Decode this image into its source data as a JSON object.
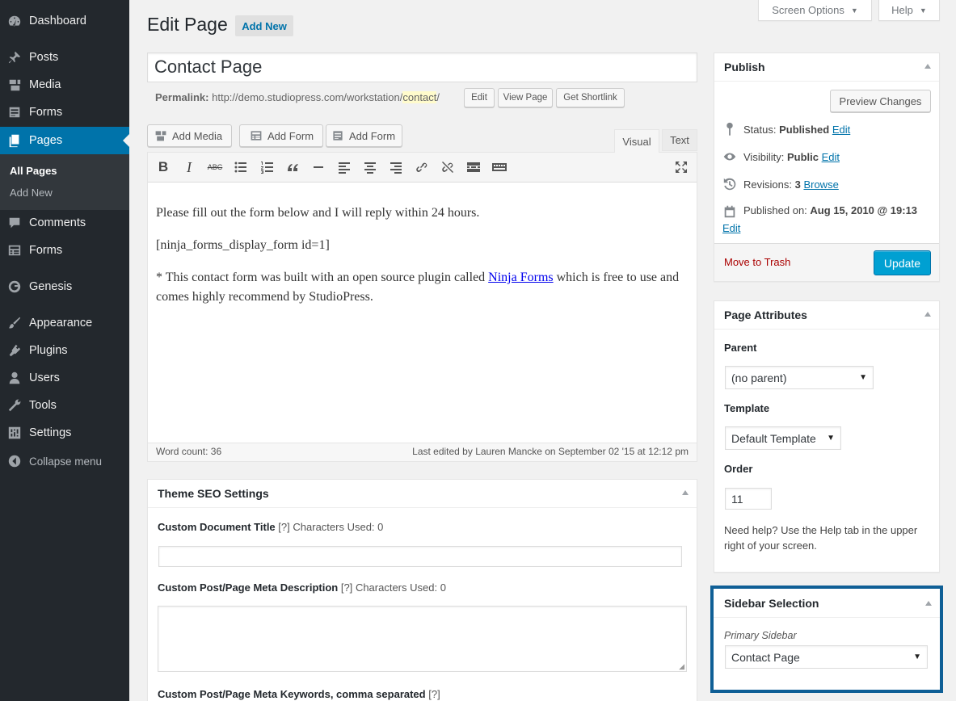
{
  "sidebar": {
    "items": [
      {
        "label": "Dashboard",
        "icon": "dashboard-icon"
      },
      {
        "label": "Posts",
        "icon": "pin-icon"
      },
      {
        "label": "Media",
        "icon": "media-icon"
      },
      {
        "label": "Forms",
        "icon": "form-icon"
      },
      {
        "label": "Pages",
        "icon": "page-icon"
      },
      {
        "label": "Comments",
        "icon": "comment-icon"
      },
      {
        "label": "Forms",
        "icon": "form-icon"
      },
      {
        "label": "Genesis",
        "icon": "genesis-icon"
      },
      {
        "label": "Appearance",
        "icon": "brush-icon"
      },
      {
        "label": "Plugins",
        "icon": "plugin-icon"
      },
      {
        "label": "Users",
        "icon": "user-icon"
      },
      {
        "label": "Tools",
        "icon": "wrench-icon"
      },
      {
        "label": "Settings",
        "icon": "settings-icon"
      },
      {
        "label": "Collapse menu",
        "icon": "collapse-icon"
      }
    ],
    "submenu": {
      "all_pages": "All Pages",
      "add_new": "Add New"
    }
  },
  "topbar": {
    "screen_options": "Screen Options",
    "help": "Help"
  },
  "header": {
    "title": "Edit Page",
    "add_new": "Add New"
  },
  "post": {
    "title": "Contact Page",
    "permalink_label": "Permalink:",
    "permalink_base": "http://demo.studiopress.com/workstation/",
    "permalink_slug": "contact",
    "permalink_end": "/",
    "edit_btn": "Edit",
    "view_btn": "View Page",
    "shortlink_btn": "Get Shortlink"
  },
  "editor": {
    "add_media": "Add Media",
    "add_form_1": "Add Form",
    "add_form_2": "Add Form",
    "tab_visual": "Visual",
    "tab_text": "Text",
    "p1": "Please fill out the form below and I will reply within 24 hours.",
    "p2": "[ninja_forms_display_form id=1]",
    "p3_a": "* This contact form was built with an open source plugin called ",
    "p3_link": "Ninja Forms",
    "p3_b": " which is free to use and comes highly recommend by StudioPress.",
    "word_count": "Word count: 36",
    "last_edited": "Last edited by Lauren Mancke on September 02 '15 at 12:12 pm"
  },
  "seo": {
    "title": "Theme SEO Settings",
    "doc_title_label": "Custom Document Title",
    "doc_title_help": "[?]",
    "doc_title_chars": "Characters Used: 0",
    "desc_label": "Custom Post/Page Meta Description",
    "desc_help": "[?]",
    "desc_chars": "Characters Used: 0",
    "keywords_label": "Custom Post/Page Meta Keywords, comma separated",
    "keywords_help": "[?]"
  },
  "publish": {
    "title": "Publish",
    "preview": "Preview Changes",
    "status_label": "Status:",
    "status_value": "Published",
    "visibility_label": "Visibility:",
    "visibility_value": "Public",
    "revisions_label": "Revisions:",
    "revisions_value": "3",
    "browse": "Browse",
    "published_label": "Published on:",
    "published_value": "Aug 15, 2010 @ 19:13",
    "edit": "Edit",
    "trash": "Move to Trash",
    "update": "Update"
  },
  "attributes": {
    "title": "Page Attributes",
    "parent_label": "Parent",
    "parent_value": "(no parent)",
    "template_label": "Template",
    "template_value": "Default Template",
    "order_label": "Order",
    "order_value": "11",
    "help": "Need help? Use the Help tab in the upper right of your screen."
  },
  "sidebar_selection": {
    "title": "Sidebar Selection",
    "primary_label": "Primary Sidebar",
    "primary_value": "Contact Page"
  },
  "colors": {
    "accent": "#0073aa",
    "highlight_border": "#0f5f96",
    "menu_bg": "#23282d",
    "update_btn": "#00a0d2"
  }
}
